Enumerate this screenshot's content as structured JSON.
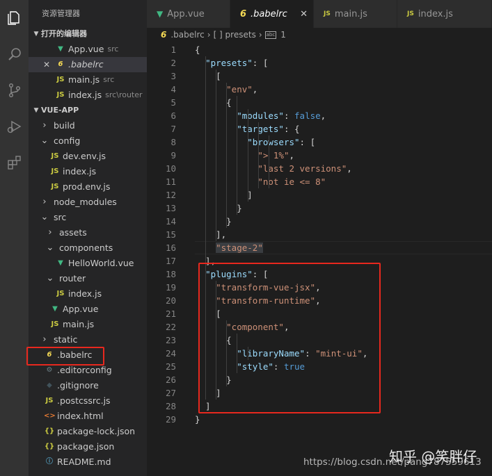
{
  "sidebar": {
    "title": "资源管理器",
    "open_editors": {
      "header": "打开的编辑器",
      "items": [
        {
          "name": "App.vue",
          "desc": "src",
          "icon": "vue-icon"
        },
        {
          "name": ".babelrc",
          "desc": "",
          "icon": "babel-icon",
          "active": true
        },
        {
          "name": "main.js",
          "desc": "src",
          "icon": "js-icon"
        },
        {
          "name": "index.js",
          "desc": "src\\router",
          "icon": "js-icon"
        }
      ]
    },
    "project": {
      "header": "VUE-APP",
      "items": [
        {
          "name": "build",
          "type": "folder-closed"
        },
        {
          "name": "config",
          "type": "folder-open"
        },
        {
          "name": "dev.env.js",
          "type": "js"
        },
        {
          "name": "index.js",
          "type": "js"
        },
        {
          "name": "prod.env.js",
          "type": "js"
        },
        {
          "name": "node_modules",
          "type": "folder-closed"
        },
        {
          "name": "src",
          "type": "folder-open"
        },
        {
          "name": "assets",
          "type": "folder-closed"
        },
        {
          "name": "components",
          "type": "folder-open"
        },
        {
          "name": "HelloWorld.vue",
          "type": "vue"
        },
        {
          "name": "router",
          "type": "folder-open"
        },
        {
          "name": "index.js",
          "type": "js"
        },
        {
          "name": "App.vue",
          "type": "vue"
        },
        {
          "name": "main.js",
          "type": "js"
        },
        {
          "name": "static",
          "type": "folder-closed"
        },
        {
          "name": ".babelrc",
          "type": "babel"
        },
        {
          "name": ".editorconfig",
          "type": "gear"
        },
        {
          "name": ".gitignore",
          "type": "git"
        },
        {
          "name": ".postcssrc.js",
          "type": "js"
        },
        {
          "name": "index.html",
          "type": "html"
        },
        {
          "name": "package-lock.json",
          "type": "json"
        },
        {
          "name": "package.json",
          "type": "json"
        },
        {
          "name": "README.md",
          "type": "info"
        }
      ]
    }
  },
  "tabs": [
    {
      "label": "App.vue",
      "icon": "vue-icon"
    },
    {
      "label": ".babelrc",
      "icon": "babel-icon",
      "active": true
    },
    {
      "label": "main.js",
      "icon": "js-icon"
    },
    {
      "label": "index.js",
      "icon": "js-icon"
    }
  ],
  "tab_icon_text": {
    "js": "JS",
    "babel": "6",
    "vue": "V"
  },
  "breadcrumb": {
    "file": ".babelrc",
    "node1": "[ ] presets",
    "node2": "1"
  },
  "code_lines": [
    "{",
    "  \"presets\": [",
    "    [",
    "      \"env\",",
    "      {",
    "        \"modules\": false,",
    "        \"targets\": {",
    "          \"browsers\": [",
    "            \"> 1%\",",
    "            \"last 2 versions\",",
    "            \"not ie <= 8\"",
    "          ]",
    "        }",
    "      }",
    "    ],",
    "    \"stage-2\"",
    "  ],",
    "  \"plugins\": [",
    "    \"transform-vue-jsx\",",
    "    \"transform-runtime\",",
    "    [",
    "      \"component\",",
    "      {",
    "        \"libraryName\": \"mint-ui\",",
    "        \"style\": true",
    "      }",
    "    ]",
    "  ]",
    "}"
  ],
  "watermark": {
    "zhihu": "知乎 @笑胖仔",
    "url": "https://blog.csdn.net/pang787559613"
  },
  "colors": {
    "string": "#ce9178",
    "key": "#9cdcfe",
    "boolean": "#569cd6",
    "highlight_box": "#e8281e"
  }
}
